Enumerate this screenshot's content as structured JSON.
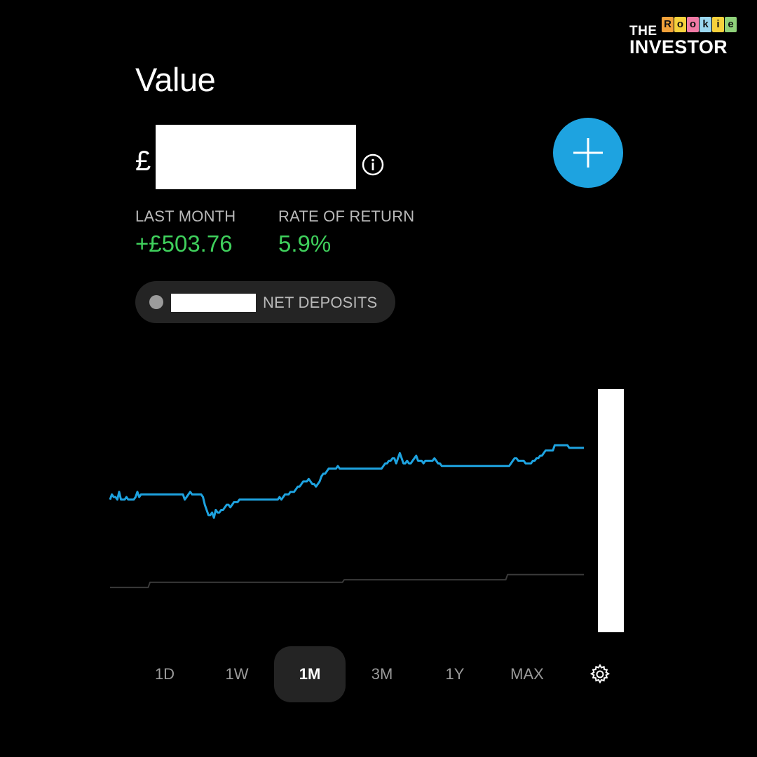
{
  "brand": {
    "the": "THE",
    "rookie_letters": [
      {
        "ch": "R",
        "bg": "#f2a23a"
      },
      {
        "ch": "o",
        "bg": "#f6d13c"
      },
      {
        "ch": "o",
        "bg": "#f07aa5"
      },
      {
        "ch": "k",
        "bg": "#9bd7ef"
      },
      {
        "ch": "i",
        "bg": "#f6d13c"
      },
      {
        "ch": "e",
        "bg": "#8fd27a"
      }
    ],
    "investor": "INVESTOR"
  },
  "header": {
    "title": "Value",
    "currency_symbol": "£"
  },
  "stats": {
    "last_month_label": "LAST MONTH",
    "last_month_value": "+£503.76",
    "rate_label": "RATE OF RETURN",
    "rate_value": "5.9%"
  },
  "legend": {
    "net_deposits_label": "NET DEPOSITS"
  },
  "ranges": {
    "items": [
      {
        "label": "1D",
        "active": false
      },
      {
        "label": "1W",
        "active": false
      },
      {
        "label": "1M",
        "active": true
      },
      {
        "label": "3M",
        "active": false
      },
      {
        "label": "1Y",
        "active": false
      },
      {
        "label": "MAX",
        "active": false
      }
    ]
  },
  "icons": {
    "add": "plus-icon",
    "info": "info-icon",
    "settings": "gear-icon"
  },
  "colors": {
    "accent": "#1ea3e0",
    "positive": "#3fd05c",
    "deposits_line": "#3a3a3a",
    "background": "#000000"
  },
  "chart_data": {
    "type": "line",
    "series": [
      {
        "values": [
          44,
          46,
          45,
          45,
          44,
          47,
          44,
          44,
          44,
          45,
          44,
          44,
          44,
          44,
          45,
          47,
          45,
          46,
          46,
          46,
          46,
          46,
          46,
          46,
          46,
          46,
          46,
          46,
          46,
          46,
          46,
          46,
          46,
          46,
          46,
          46,
          46,
          46,
          46,
          46,
          46,
          44,
          45,
          46,
          47,
          46,
          46,
          46,
          46,
          46,
          46,
          45,
          42,
          40,
          38,
          38,
          39,
          37,
          40,
          39,
          39,
          40,
          40,
          41,
          42,
          42,
          41,
          42,
          43,
          43,
          43,
          44,
          44,
          44,
          44,
          44,
          44,
          44,
          44,
          44,
          44,
          44,
          44,
          44,
          44,
          44,
          44,
          44,
          44,
          44,
          44,
          44,
          44,
          45,
          44,
          45,
          46,
          46,
          46,
          47,
          47,
          47,
          48,
          49,
          49,
          50,
          51,
          51,
          51,
          52,
          51,
          50,
          50,
          49,
          50,
          51,
          53,
          54,
          54,
          55,
          56,
          56,
          56,
          56,
          56,
          57,
          56,
          56,
          56,
          56,
          56,
          56,
          56,
          56,
          56,
          56,
          56,
          56,
          56,
          56,
          56,
          56,
          56,
          56,
          56,
          56,
          56,
          56,
          56,
          56,
          57,
          58,
          58,
          59,
          59,
          60,
          60,
          58,
          60,
          62,
          60,
          58,
          58,
          59,
          58,
          58,
          59,
          60,
          61,
          59,
          59,
          59,
          58,
          59,
          59,
          59,
          59,
          59,
          60,
          59,
          58,
          58,
          57,
          57,
          57,
          57,
          57,
          57,
          57,
          57,
          57,
          57,
          57,
          57,
          57,
          57,
          57,
          57,
          57,
          57,
          57,
          57,
          57,
          57,
          57,
          57,
          57,
          57,
          57,
          57,
          57,
          57,
          57,
          57,
          57,
          57,
          57,
          57,
          57,
          57,
          58,
          59,
          60,
          60,
          59,
          59,
          59,
          59,
          58,
          58,
          58,
          58,
          59,
          59,
          60,
          60,
          61,
          61,
          62,
          63,
          63,
          63,
          63,
          63,
          65,
          65,
          65,
          65,
          65,
          65,
          65,
          65,
          64,
          64,
          64,
          64,
          64,
          64,
          64,
          64,
          64
        ]
      },
      {
        "values": [
          10,
          10,
          10,
          10,
          10,
          10,
          10,
          10,
          10,
          10,
          10,
          10,
          10,
          10,
          10,
          10,
          10,
          10,
          10,
          10,
          10,
          10,
          12,
          12,
          12,
          12,
          12,
          12,
          12,
          12,
          12,
          12,
          12,
          12,
          12,
          12,
          12,
          12,
          12,
          12,
          12,
          12,
          12,
          12,
          12,
          12,
          12,
          12,
          12,
          12,
          12,
          12,
          12,
          12,
          12,
          12,
          12,
          12,
          12,
          12,
          12,
          12,
          12,
          12,
          12,
          12,
          12,
          12,
          12,
          12,
          12,
          12,
          12,
          12,
          12,
          12,
          12,
          12,
          12,
          12,
          12,
          12,
          12,
          12,
          12,
          12,
          12,
          12,
          12,
          12,
          12,
          12,
          12,
          12,
          12,
          12,
          12,
          12,
          12,
          12,
          12,
          12,
          12,
          12,
          12,
          12,
          12,
          12,
          12,
          12,
          12,
          12,
          12,
          12,
          12,
          12,
          12,
          12,
          12,
          12,
          12,
          12,
          12,
          12,
          12,
          12,
          12,
          12,
          12,
          13,
          13,
          13,
          13,
          13,
          13,
          13,
          13,
          13,
          13,
          13,
          13,
          13,
          13,
          13,
          13,
          13,
          13,
          13,
          13,
          13,
          13,
          13,
          13,
          13,
          13,
          13,
          13,
          13,
          13,
          13,
          13,
          13,
          13,
          13,
          13,
          13,
          13,
          13,
          13,
          13,
          13,
          13,
          13,
          13,
          13,
          13,
          13,
          13,
          13,
          13,
          13,
          13,
          13,
          13,
          13,
          13,
          13,
          13,
          13,
          13,
          13,
          13,
          13,
          13,
          13,
          13,
          13,
          13,
          13,
          13,
          13,
          13,
          13,
          13,
          13,
          13,
          13,
          13,
          13,
          13,
          13,
          13,
          13,
          13,
          13,
          13,
          13,
          13,
          13,
          15,
          15,
          15,
          15,
          15,
          15,
          15,
          15,
          15,
          15,
          15,
          15,
          15,
          15,
          15,
          15,
          15,
          15,
          15,
          15,
          15,
          15,
          15,
          15,
          15,
          15,
          15,
          15,
          15,
          15,
          15,
          15,
          15,
          15,
          15,
          15,
          15,
          15,
          15,
          15,
          15,
          15,
          15
        ]
      }
    ]
  }
}
